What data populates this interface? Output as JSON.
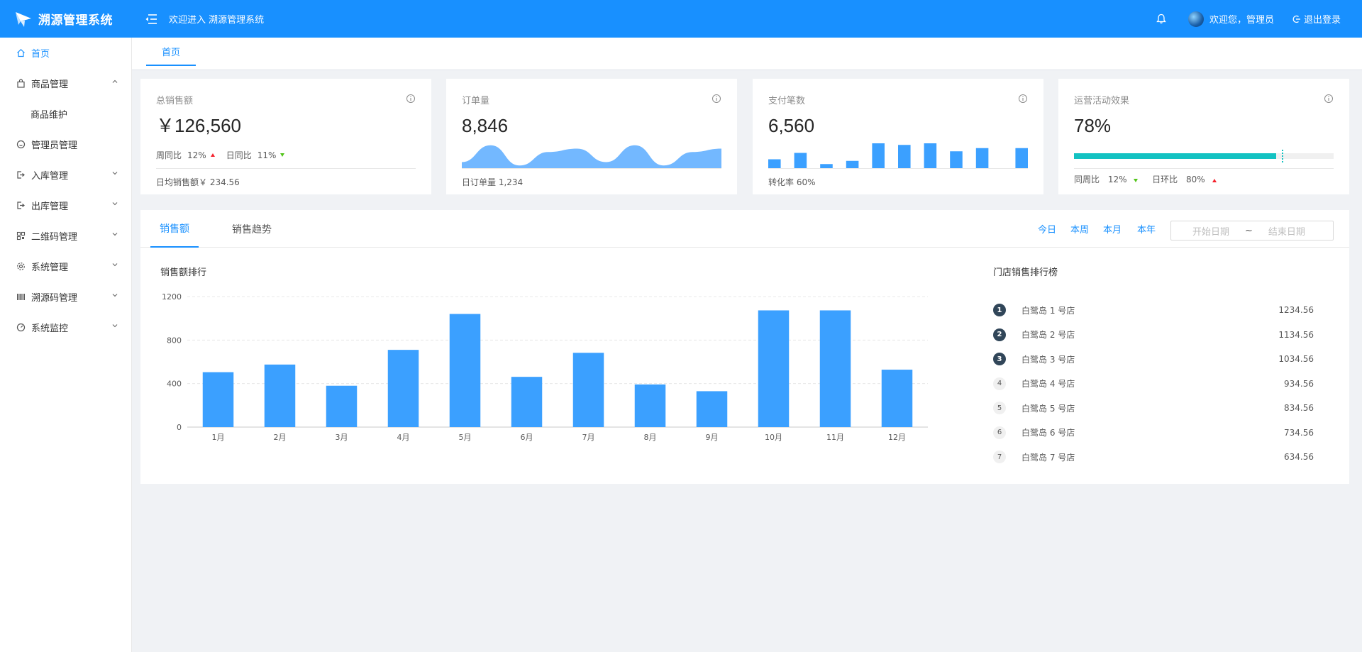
{
  "header": {
    "app_title": "溯源管理系统",
    "welcome": "欢迎进入 溯源管理系统",
    "user_welcome": "欢迎您，管理员",
    "logout": "退出登录"
  },
  "sidebar": {
    "items": [
      {
        "label": "首页",
        "icon": "home-icon"
      },
      {
        "label": "商品管理",
        "icon": "bag-icon"
      },
      {
        "label": "商品维护",
        "icon": ""
      },
      {
        "label": "管理员管理",
        "icon": "user-circle-icon"
      },
      {
        "label": "入库管理",
        "icon": "login-icon"
      },
      {
        "label": "出库管理",
        "icon": "logout-box-icon"
      },
      {
        "label": "二维码管理",
        "icon": "qrcode-icon"
      },
      {
        "label": "系统管理",
        "icon": "settings-icon"
      },
      {
        "label": "溯源码管理",
        "icon": "barcode-icon"
      },
      {
        "label": "系统监控",
        "icon": "gauge-icon"
      }
    ]
  },
  "tabs": {
    "home": "首页"
  },
  "cards": {
    "total_sales": {
      "title": "总销售额",
      "value": "￥126,560",
      "wow_label": "周同比",
      "wow_value": "12%",
      "dod_label": "日同比",
      "dod_value": "11%",
      "footer": "日均销售额￥ 234.56"
    },
    "orders": {
      "title": "订单量",
      "value": "8,846",
      "footer": "日订单量 1,234"
    },
    "payments": {
      "title": "支付笔数",
      "value": "6,560",
      "footer": "转化率 60%"
    },
    "campaign": {
      "title": "运营活动效果",
      "value": "78%",
      "progress_percent": 78,
      "target_percent": 80,
      "yoy_label": "同周比",
      "yoy_value": "12%",
      "mom_label": "日环比",
      "mom_value": "80%"
    }
  },
  "panel": {
    "tabs": [
      "销售额",
      "销售趋势"
    ],
    "ranges": [
      "今日",
      "本周",
      "本月",
      "本年"
    ],
    "start_placeholder": "开始日期",
    "separator": "~",
    "end_placeholder": "结束日期",
    "chart_title": "销售额排行",
    "ranking_title": "门店销售排行榜",
    "ranking": [
      {
        "rank": "1",
        "name": "白鹭岛 1 号店",
        "value": "1234.56"
      },
      {
        "rank": "2",
        "name": "白鹭岛 2 号店",
        "value": "1134.56"
      },
      {
        "rank": "3",
        "name": "白鹭岛 3 号店",
        "value": "1034.56"
      },
      {
        "rank": "4",
        "name": "白鹭岛 4 号店",
        "value": "934.56"
      },
      {
        "rank": "5",
        "name": "白鹭岛 5 号店",
        "value": "834.56"
      },
      {
        "rank": "6",
        "name": "白鹭岛 6 号店",
        "value": "734.56"
      },
      {
        "rank": "7",
        "name": "白鹭岛 7 号店",
        "value": "634.56"
      }
    ]
  },
  "colors": {
    "primary": "#1890ff",
    "bar": "#3ba0ff",
    "area": "#73b8ff",
    "progress": "#13c2c2",
    "up": "#f5222d",
    "down": "#52c41a"
  },
  "chart_data": [
    {
      "type": "bar",
      "title": "销售额排行",
      "categories": [
        "1月",
        "2月",
        "3月",
        "4月",
        "5月",
        "6月",
        "7月",
        "8月",
        "9月",
        "10月",
        "11月",
        "12月"
      ],
      "values": [
        505,
        575,
        380,
        710,
        1040,
        462,
        683,
        392,
        330,
        1073,
        1073,
        528
      ],
      "yticks": [
        0,
        400,
        800,
        1200
      ],
      "ylim": [
        0,
        1200
      ],
      "grid": true
    },
    {
      "type": "area",
      "values": [
        2,
        7,
        1,
        5,
        6,
        2,
        7,
        1,
        5,
        6
      ],
      "ylim": [
        0,
        8
      ]
    },
    {
      "type": "bar",
      "values": [
        3,
        5,
        1.5,
        2.5,
        8,
        7.5,
        8,
        5.5,
        6.5,
        6.5
      ],
      "ylim": [
        0,
        8
      ]
    }
  ]
}
